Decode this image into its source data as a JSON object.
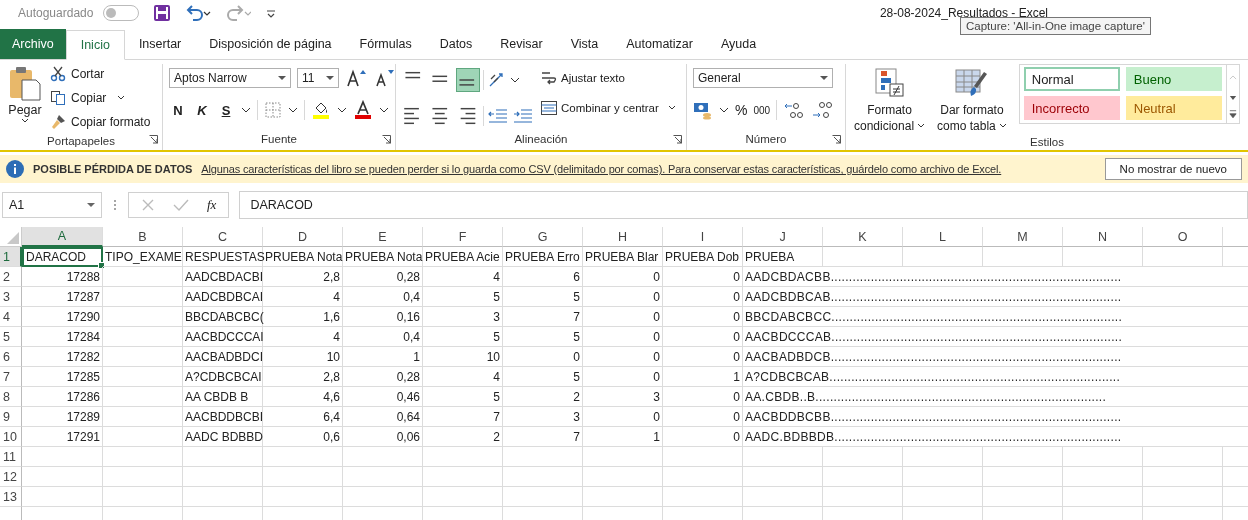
{
  "title_bar": {
    "autosave_label": "Autoguardado",
    "autosave_on": false,
    "document_title": "28-08-2024_Resultados  -  Excel",
    "tooltip": "Capture: 'All-in-One image capture'"
  },
  "tabs": [
    {
      "label": "Archivo",
      "kind": "file",
      "selected": false
    },
    {
      "label": "Inicio",
      "kind": "tab",
      "selected": true
    },
    {
      "label": "Insertar",
      "kind": "tab",
      "selected": false
    },
    {
      "label": "Disposición de página",
      "kind": "tab",
      "selected": false
    },
    {
      "label": "Fórmulas",
      "kind": "tab",
      "selected": false
    },
    {
      "label": "Datos",
      "kind": "tab",
      "selected": false
    },
    {
      "label": "Revisar",
      "kind": "tab",
      "selected": false
    },
    {
      "label": "Vista",
      "kind": "tab",
      "selected": false
    },
    {
      "label": "Automatizar",
      "kind": "tab",
      "selected": false
    },
    {
      "label": "Ayuda",
      "kind": "tab",
      "selected": false
    }
  ],
  "ribbon": {
    "clipboard": {
      "label": "Portapapeles",
      "paste": "Pegar",
      "cut": "Cortar",
      "copy": "Copiar",
      "format_painter": "Copiar formato"
    },
    "font": {
      "label": "Fuente",
      "font_name": "Aptos Narrow",
      "font_size": "11",
      "bold": "N",
      "italic": "K",
      "underline": "S"
    },
    "alignment": {
      "label": "Alineación",
      "align_buttons": [
        {
          "kind": "top",
          "selected": false
        },
        {
          "kind": "middle",
          "selected": false
        },
        {
          "kind": "bottom",
          "selected": true
        },
        {
          "kind": "left",
          "selected": false
        },
        {
          "kind": "center",
          "selected": false
        },
        {
          "kind": "right",
          "selected": false
        }
      ],
      "wrap_text": "Ajustar texto",
      "merge_center": "Combinar y centrar"
    },
    "number": {
      "label": "Número",
      "format": "General",
      "percent": "%",
      "thousands": "000"
    },
    "styles": {
      "label": "Estilos",
      "conditional_format": [
        "Formato",
        "condicional"
      ],
      "format_as_table": [
        "Dar formato",
        "como tabla"
      ],
      "cell_styles": [
        {
          "label": "Normal",
          "kind": "normal",
          "selected": true
        },
        {
          "label": "Bueno",
          "kind": "good",
          "selected": false
        },
        {
          "label": "Incorrecto",
          "kind": "bad",
          "selected": false
        },
        {
          "label": "Neutral",
          "kind": "neutral",
          "selected": false
        }
      ]
    }
  },
  "info_bar": {
    "title": "POSIBLE PÉRDIDA DE DATOS",
    "message": "Algunas características del libro se pueden perder si lo guarda como CSV (delimitado por comas). Para conservar estas características, guárdelo como archivo de Excel.",
    "button": "No mostrar de nuevo"
  },
  "formula_bar": {
    "name_box": "A1",
    "fx": "fx",
    "formula": "DARACOD"
  },
  "grid": {
    "columns": [
      {
        "label": "A",
        "numeric": true,
        "selected": true
      },
      {
        "label": "B",
        "numeric": false,
        "selected": false
      },
      {
        "label": "C",
        "numeric": false,
        "selected": false
      },
      {
        "label": "D",
        "numeric": true,
        "selected": false
      },
      {
        "label": "E",
        "numeric": true,
        "selected": false
      },
      {
        "label": "F",
        "numeric": true,
        "selected": false
      },
      {
        "label": "G",
        "numeric": true,
        "selected": false
      },
      {
        "label": "H",
        "numeric": true,
        "selected": false
      },
      {
        "label": "I",
        "numeric": true,
        "selected": false
      },
      {
        "label": "J",
        "numeric": false,
        "selected": false
      },
      {
        "label": "K",
        "selected": false
      },
      {
        "label": "L",
        "selected": false
      },
      {
        "label": "M",
        "selected": false
      },
      {
        "label": "N",
        "selected": false
      },
      {
        "label": "O",
        "selected": false
      }
    ],
    "rows": [
      {
        "number": "1",
        "kind": "header",
        "selected": true,
        "cells": [
          "DARACOD",
          "TIPO_EXAME",
          "RESPUESTAS",
          "PRUEBA Nota",
          "PRUEBA Nota",
          "PRUEBA Acie",
          "PRUEBA Erro",
          "PRUEBA Blar",
          "PRUEBA Dob",
          "PRUEBA"
        ]
      },
      {
        "number": "2",
        "kind": "data",
        "selected": false,
        "cells": [
          "17288",
          "",
          "AADCBDACBI",
          "2,8",
          "0,28",
          "4",
          "6",
          "0",
          "0",
          "AADCBDACBB................................................................................"
        ]
      },
      {
        "number": "3",
        "kind": "data",
        "selected": false,
        "cells": [
          "17287",
          "",
          "AADCBDBCAI",
          "4",
          "0,4",
          "5",
          "5",
          "0",
          "0",
          "AADCBDBCAB................................................................................"
        ]
      },
      {
        "number": "4",
        "kind": "data",
        "selected": false,
        "cells": [
          "17290",
          "",
          "BBCDABCBC(",
          "1,6",
          "0,16",
          "3",
          "7",
          "0",
          "0",
          "BBCDABCBCC................................................................................"
        ]
      },
      {
        "number": "5",
        "kind": "data",
        "selected": false,
        "cells": [
          "17284",
          "",
          "AACBDCCCAI",
          "4",
          "0,4",
          "5",
          "5",
          "0",
          "0",
          "AACBDCCCAB................................................................................"
        ]
      },
      {
        "number": "6",
        "kind": "data",
        "selected": false,
        "cells": [
          "17282",
          "",
          "AACBADBDCI",
          "10",
          "1",
          "10",
          "0",
          "0",
          "0",
          "AACBADBDCB................................................................................"
        ]
      },
      {
        "number": "7",
        "kind": "data",
        "selected": false,
        "cells": [
          "17285",
          "",
          "A?CDBCBCAI",
          "2,8",
          "0,28",
          "4",
          "5",
          "0",
          "1",
          "A?CDBCBCAB................................................................................"
        ]
      },
      {
        "number": "8",
        "kind": "data",
        "selected": false,
        "cells": [
          "17286",
          "",
          "AA CBDB  B",
          "4,6",
          "0,46",
          "5",
          "2",
          "3",
          "0",
          "AA.CBDB..B................................................................................"
        ]
      },
      {
        "number": "9",
        "kind": "data",
        "selected": false,
        "cells": [
          "17289",
          "",
          "AACBDDBCBI",
          "6,4",
          "0,64",
          "7",
          "3",
          "0",
          "0",
          "AACBDDBCBB................................................................................"
        ]
      },
      {
        "number": "10",
        "kind": "data",
        "selected": false,
        "cells": [
          "17291",
          "",
          "AADC BDBBD",
          "0,6",
          "0,06",
          "2",
          "7",
          "1",
          "0",
          "AADC.BDBBDB..............................................................................."
        ]
      },
      {
        "number": "11",
        "kind": "empty",
        "selected": false
      },
      {
        "number": "12",
        "kind": "empty",
        "selected": false
      },
      {
        "number": "13",
        "kind": "empty",
        "selected": false
      }
    ]
  }
}
